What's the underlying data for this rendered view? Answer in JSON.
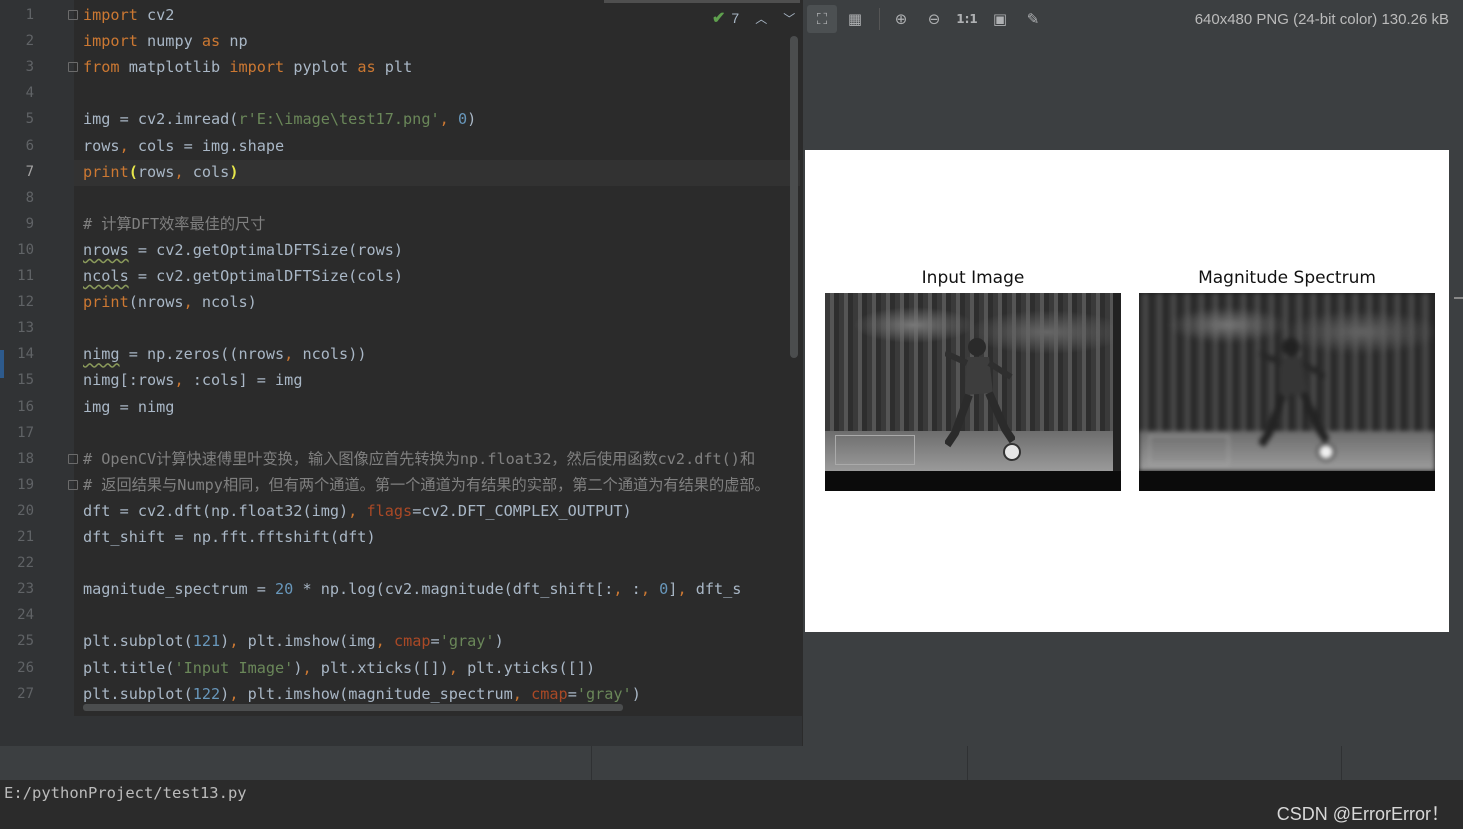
{
  "editor": {
    "inspection_count": "7",
    "current_line": 7,
    "lines": [
      {
        "n": "1",
        "html": "<span class='kw'>import</span> cv2"
      },
      {
        "n": "2",
        "html": "<span class='kw'>import</span> numpy <span class='kw'>as</span> np"
      },
      {
        "n": "3",
        "html": "<span class='kw'>from</span> matplotlib <span class='kw'>import</span> pyplot <span class='kw'>as</span> plt"
      },
      {
        "n": "4",
        "html": ""
      },
      {
        "n": "5",
        "html": "img = cv2.imread(<span class='str'>r'E:\\image\\test17.png'</span><span class='kw'>,</span> <span class='num'>0</span>)"
      },
      {
        "n": "6",
        "html": "rows<span class='kw'>,</span> cols = img.shape"
      },
      {
        "n": "7",
        "html": "<span class='kw'>print</span><span class='bm'>(</span>rows<span class='kw'>,</span> cols<span class='bm'>)</span>"
      },
      {
        "n": "8",
        "html": ""
      },
      {
        "n": "9",
        "html": "<span class='cm'># 计算DFT效率最佳的尺寸</span>"
      },
      {
        "n": "10",
        "html": "<span class='sq'>nrows</span> = cv2.getOptimalDFTSize(rows)"
      },
      {
        "n": "11",
        "html": "<span class='sq'>ncols</span> = cv2.getOptimalDFTSize(cols)"
      },
      {
        "n": "12",
        "html": "<span class='kw'>print</span>(nrows<span class='kw'>,</span> ncols)"
      },
      {
        "n": "13",
        "html": ""
      },
      {
        "n": "14",
        "html": "<span class='sq'>nimg</span> = np.zeros((nrows<span class='kw'>,</span> ncols))"
      },
      {
        "n": "15",
        "html": "nimg[:rows<span class='kw'>,</span> :cols] = img"
      },
      {
        "n": "16",
        "html": "img = nimg"
      },
      {
        "n": "17",
        "html": ""
      },
      {
        "n": "18",
        "html": "<span class='cm'># OpenCV计算快速傅里叶变换，输入图像应首先转换为np.float32，然后使用函数cv2.dft()和</span>"
      },
      {
        "n": "19",
        "html": "<span class='cm'># 返回结果与Numpy相同，但有两个通道。第一个通道为有结果的实部，第二个通道为有结果的虚部。</span>"
      },
      {
        "n": "20",
        "html": "dft = cv2.dft(np.float32(img)<span class='kw'>,</span> <span class='par'>flags</span>=cv2.DFT_COMPLEX_OUTPUT)"
      },
      {
        "n": "21",
        "html": "dft_shift = np.fft.fftshift(dft)"
      },
      {
        "n": "22",
        "html": ""
      },
      {
        "n": "23",
        "html": "magnitude_spectrum = <span class='num'>20</span> * np.log(cv2.magnitude(dft_shift[:<span class='kw'>,</span> :<span class='kw'>,</span> <span class='num'>0</span>]<span class='kw'>,</span> dft_s"
      },
      {
        "n": "24",
        "html": ""
      },
      {
        "n": "25",
        "html": "plt.subplot(<span class='num'>121</span>)<span class='kw'>,</span> plt.imshow(img<span class='kw'>,</span> <span class='par'>cmap</span>=<span class='str'>'gray'</span>)"
      },
      {
        "n": "26",
        "html": "plt.title(<span class='str'>'Input Image'</span>)<span class='kw'>,</span> plt.xticks([])<span class='kw'>,</span> plt.yticks([])"
      },
      {
        "n": "27",
        "html": "plt.subplot(<span class='num'>122</span>)<span class='kw'>,</span> plt.imshow(magnitude_spectrum<span class='kw'>,</span> <span class='par'>cmap</span>=<span class='str'>'gray'</span>)"
      }
    ]
  },
  "viewer": {
    "image_info": "640x480 PNG (24-bit color) 130.26 kB",
    "tools": [
      {
        "name": "fit-to-window-icon",
        "glyph": "⛶",
        "active": true
      },
      {
        "name": "grid-icon",
        "glyph": "▦",
        "active": false
      },
      {
        "name": "zoom-in-icon",
        "glyph": "⊕",
        "active": false
      },
      {
        "name": "zoom-out-icon",
        "glyph": "⊖",
        "active": false
      },
      {
        "name": "actual-size-icon",
        "glyph": "1:1",
        "active": false
      },
      {
        "name": "background-icon",
        "glyph": "▣",
        "active": false
      },
      {
        "name": "color-picker-icon",
        "glyph": "✎",
        "active": false
      }
    ],
    "plot_titles": {
      "left": "Input Image",
      "right": "Magnitude Spectrum"
    }
  },
  "console": {
    "line": "E:/pythonProject/test13.py"
  },
  "watermark": "CSDN @ErrorError！"
}
